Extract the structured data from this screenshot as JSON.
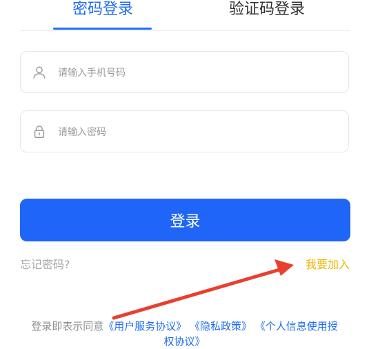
{
  "tabs": {
    "password_login": "密码登录",
    "code_login": "验证码登录"
  },
  "fields": {
    "phone_placeholder": "请输入手机号码",
    "password_placeholder": "请输入密码"
  },
  "login_button": "登录",
  "forgot_password": "忘记密码?",
  "join": "我要加入",
  "agreement": {
    "prefix": "登录即表示同意",
    "user_service": "《用户服务协议》",
    "privacy": "《隐私政策》",
    "personal_info": "《个人信息使用授权协议》"
  },
  "colors": {
    "primary": "#1f66f8",
    "join": "#f0b400",
    "arrow": "#e8402f"
  }
}
